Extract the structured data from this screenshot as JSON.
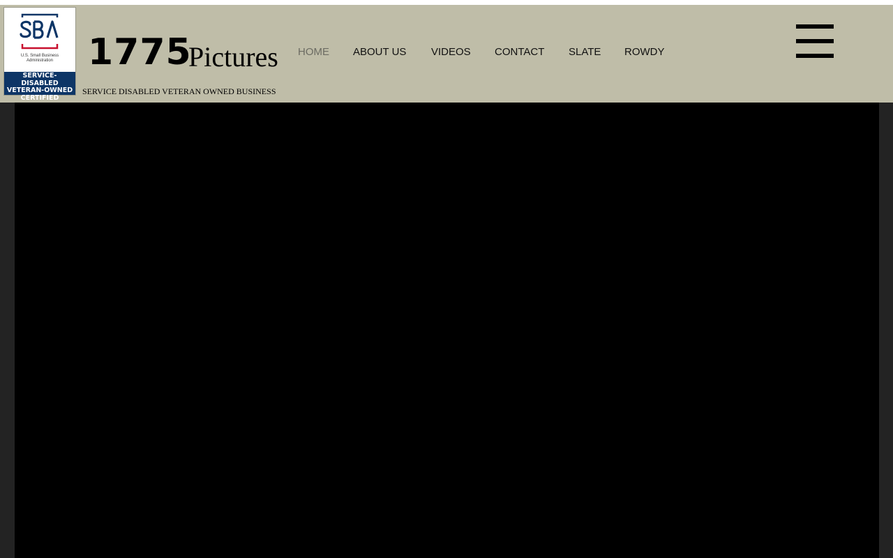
{
  "badge": {
    "logo_text": "SBA",
    "subtitle_line1": "U.S. Small Business",
    "subtitle_line2": "Administration",
    "cert_line1": "SERVICE-DISABLED",
    "cert_line2": "VETERAN-OWNED",
    "cert_line3": "CERTIFIED",
    "colors": {
      "navy": "#0d3566",
      "red": "#c8102e"
    }
  },
  "brand": {
    "number": "1775",
    "word": "Pictures",
    "tagline": "SERVICE DISABLED VETERAN OWNED BUSINESS"
  },
  "nav": {
    "items": [
      {
        "label": "HOME",
        "active": true
      },
      {
        "label": "ABOUT US",
        "active": false
      },
      {
        "label": "VIDEOS",
        "active": false
      },
      {
        "label": "CONTACT",
        "active": false
      },
      {
        "label": "SLATE",
        "active": false
      },
      {
        "label": "ROWDY",
        "active": false
      }
    ],
    "menu_icon": "hamburger-menu-icon"
  },
  "colors": {
    "header_bg": "#bfbda8",
    "page_bg": "#232323",
    "video_bg": "#000000",
    "active_nav": "#6b6b62"
  }
}
